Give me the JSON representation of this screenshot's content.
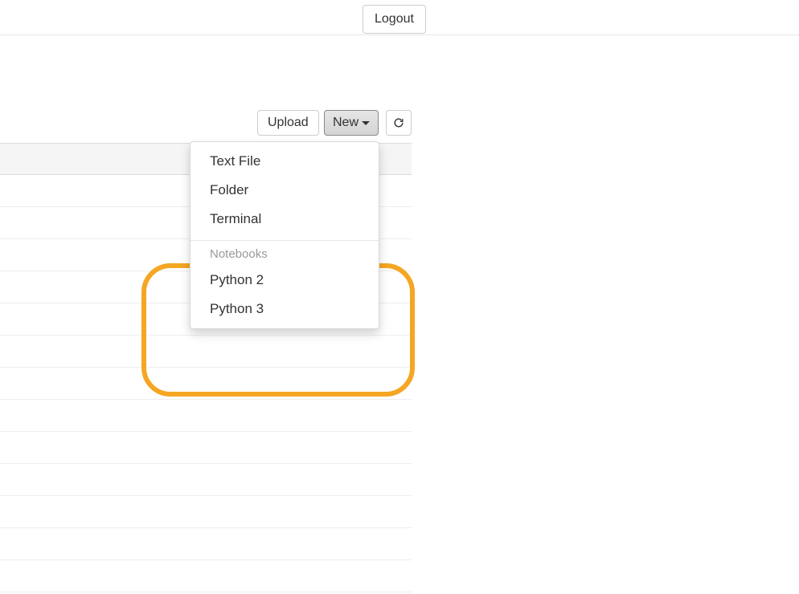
{
  "header": {
    "logout_label": "Logout"
  },
  "toolbar": {
    "upload_label": "Upload",
    "new_label": "New",
    "refresh_title": "Refresh"
  },
  "dropdown": {
    "items_top": [
      {
        "label": "Text File"
      },
      {
        "label": "Folder"
      },
      {
        "label": "Terminal"
      }
    ],
    "section_header": "Notebooks",
    "items_notebooks": [
      {
        "label": "Python 2"
      },
      {
        "label": "Python 3"
      }
    ]
  },
  "annotation": {
    "highlight_color": "#f5a623"
  }
}
